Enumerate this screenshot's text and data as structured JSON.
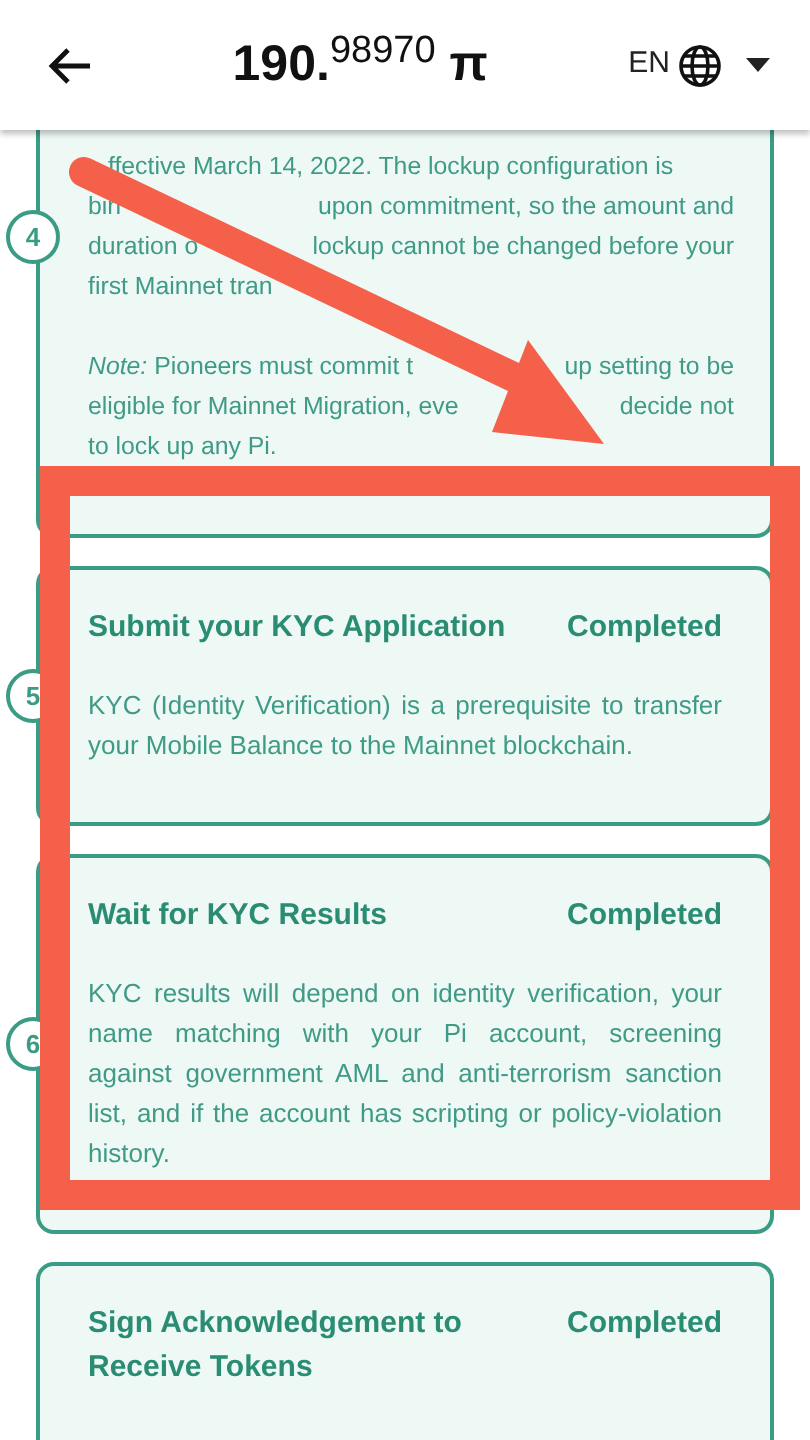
{
  "header": {
    "balance_whole": "190.",
    "balance_fraction": "98970",
    "currency": "π",
    "language": "EN"
  },
  "steps": [
    {
      "number": "4",
      "line_paragraphs": [
        {
          "lines": [
            {
              "segments": [
                "ffective March 14, 2022. The lockup configuration is"
              ]
            },
            {
              "segments": [
                "bin",
                "upon commitment, so the amount and"
              ]
            },
            {
              "segments": [
                "duration o",
                "lockup cannot be changed before your"
              ]
            },
            {
              "segments": [
                "first Mainnet tran"
              ]
            }
          ]
        },
        {
          "lines": [
            {
              "segments": [
                "*Note:* Pioneers must commit t",
                "up setting to be"
              ]
            },
            {
              "segments": [
                "eligible for Mainnet Migration, eve",
                "decide not"
              ]
            },
            {
              "segments": [
                "to lock up any Pi."
              ]
            }
          ]
        }
      ]
    },
    {
      "number": "5",
      "title": "Submit your KYC Application",
      "status": "Completed",
      "paragraphs": [
        {
          "text": "KYC (Identity Verification) is a prerequisite to transfer your Mobile Balance to the Mainnet blockchain."
        }
      ]
    },
    {
      "number": "6",
      "title": "Wait for KYC Results",
      "status": "Completed",
      "paragraphs": [
        {
          "text": "KYC results will depend on identity verification, your name matching with your Pi account, screening against government AML and anti-terrorism sanction list, and if the account has scripting or policy-violation history."
        }
      ]
    },
    {
      "title": "Sign Acknowledgement to Receive Tokens",
      "status": "Completed"
    }
  ],
  "annotations": {
    "arrow": true,
    "highlight_frame": true
  }
}
